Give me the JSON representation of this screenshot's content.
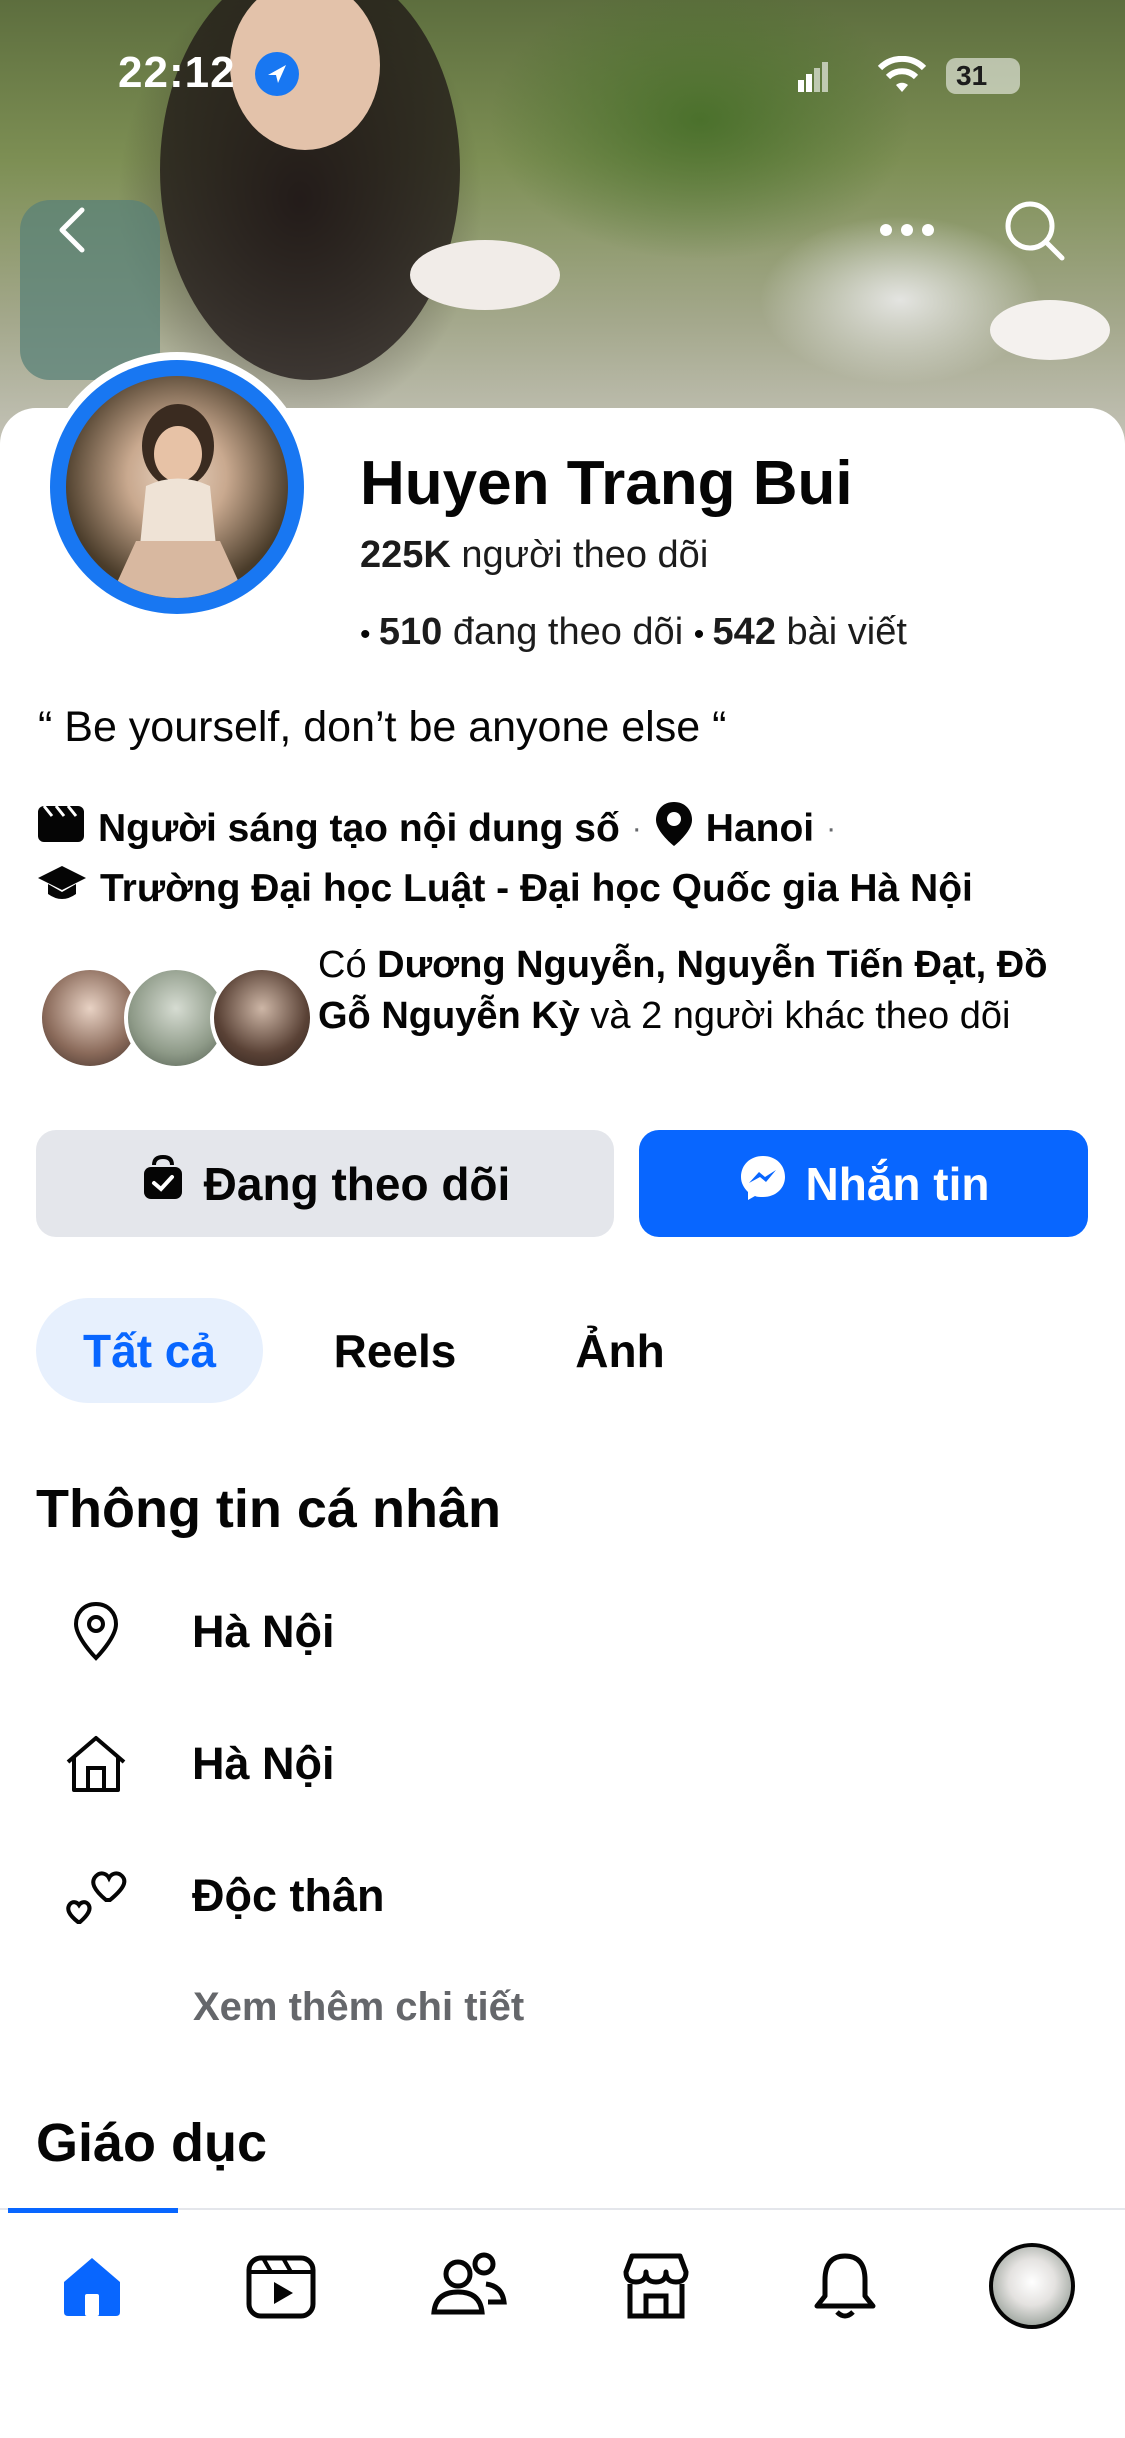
{
  "status_bar": {
    "time": "22:12",
    "battery": "31"
  },
  "profile": {
    "name": "Huyen Trang Bui",
    "followers_count": "225K",
    "followers_label": "người theo dõi",
    "following_count": "510",
    "following_label": "đang theo dõi",
    "posts_count": "542",
    "posts_label": "bài viết",
    "bio": "“  Be yourself,  don’t be anyone else “"
  },
  "info": {
    "role": "Người sáng tạo nội dung số",
    "location": "Hanoi",
    "school": "Trường Đại học Luật - Đại học Quốc gia Hà Nội"
  },
  "mutual": {
    "prefix": "Có",
    "names": "Dương Nguyễn, Nguyễn Tiến Đạt, Đồ Gỗ Nguyễn Kỳ",
    "suffix": "và 2 người khác theo dõi"
  },
  "actions": {
    "following_label": "Đang theo dõi",
    "message_label": "Nhắn tin"
  },
  "tabs": [
    {
      "label": "Tất cả",
      "active": true
    },
    {
      "label": "Reels",
      "active": false
    },
    {
      "label": "Ảnh",
      "active": false
    }
  ],
  "personal_info": {
    "title": "Thông tin cá nhân",
    "items": [
      {
        "icon": "location-pin-icon",
        "text": "Hà Nội"
      },
      {
        "icon": "home-icon",
        "text": "Hà Nội"
      },
      {
        "icon": "relationship-hearts-icon",
        "text": "Độc thân"
      }
    ],
    "see_more": "Xem thêm chi tiết"
  },
  "education": {
    "title": "Giáo dục"
  },
  "bottom_nav": [
    {
      "icon": "home-icon",
      "active": true
    },
    {
      "icon": "video-icon",
      "active": false
    },
    {
      "icon": "friends-icon",
      "active": false
    },
    {
      "icon": "marketplace-icon",
      "active": false
    },
    {
      "icon": "bell-icon",
      "active": false
    },
    {
      "icon": "profile-avatar",
      "active": false
    }
  ],
  "colors": {
    "accent": "#0866ff",
    "gray_button": "#e4e6eb",
    "tab_active_bg": "#e7f0fd",
    "secondary_text": "#65676b"
  }
}
